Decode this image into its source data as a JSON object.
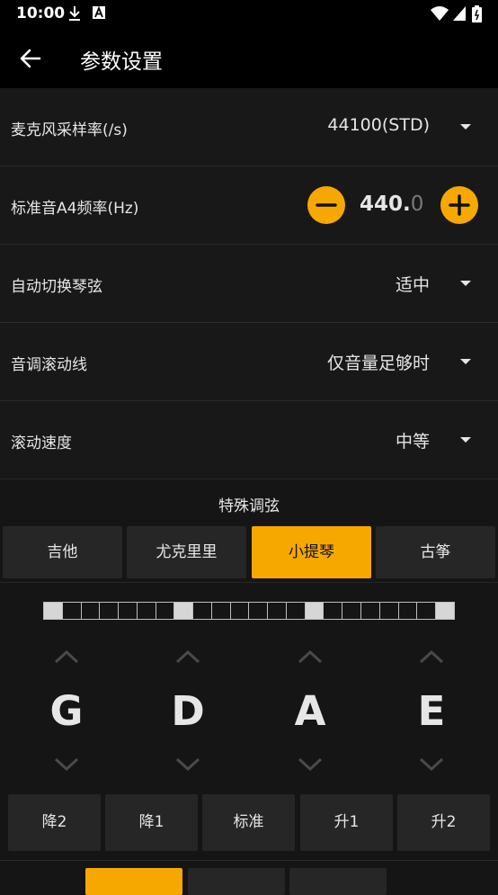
{
  "status": {
    "time": "10:00"
  },
  "appbar": {
    "title": "参数设置"
  },
  "settings": {
    "mic_rate": {
      "label": "麦克风采样率(/s)",
      "value": "44100(STD)"
    },
    "a4": {
      "label": "标准音A4频率(Hz)",
      "value_int": "440.",
      "value_frac": "0"
    },
    "auto_switch": {
      "label": "自动切换琴弦",
      "value": "适中"
    },
    "pitch_line": {
      "label": "音调滚动线",
      "value": "仅音量足够时"
    },
    "scroll_speed": {
      "label": "滚动速度",
      "value": "中等"
    }
  },
  "special_tuning": {
    "title": "特殊调弦",
    "tabs": [
      "吉他",
      "尤克里里",
      "小提琴",
      "古筝"
    ],
    "active_tab": "小提琴"
  },
  "strings": [
    "G",
    "D",
    "A",
    "E"
  ],
  "shift_buttons": [
    "降2",
    "降1",
    "标准",
    "升1",
    "升2"
  ],
  "colors": {
    "accent": "#f7a800",
    "background": "#151515",
    "row": "#181818",
    "button": "#262626"
  },
  "icons": [
    "back-arrow-icon",
    "download-icon",
    "text-a-icon",
    "wifi-icon",
    "signal-icon",
    "battery-icon",
    "caret-down-icon",
    "minus-icon",
    "plus-icon",
    "chevron-up-icon",
    "chevron-down-icon"
  ]
}
